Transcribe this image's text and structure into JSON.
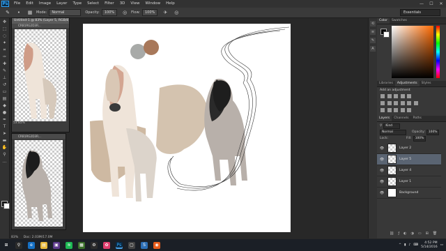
{
  "app": {
    "logo_text": "Ps"
  },
  "menu": {
    "items": [
      "File",
      "Edit",
      "Image",
      "Layer",
      "Type",
      "Select",
      "Filter",
      "3D",
      "View",
      "Window",
      "Help"
    ]
  },
  "window_controls": {
    "minimize": "—",
    "maximize": "☐",
    "close": "✕"
  },
  "options_bar": {
    "mode_label": "Mode:",
    "mode_value": "Normal",
    "opacity_label": "Opacity:",
    "opacity_value": "100%",
    "flow_label": "Flow:",
    "flow_value": "100%",
    "workspace": "Essentials"
  },
  "documents": {
    "floating_1": {
      "title": "Untitled-1 @ 83% (Layer 5, RGB/8) ×",
      "tab": "CRB1RG2D3R...",
      "zoom": "53.85%"
    },
    "floating_2": {
      "tab": "CRB1RG2D3R..."
    }
  },
  "main_status": {
    "zoom": "83%",
    "doc_info": "Doc: 2.03M/17.0M"
  },
  "color_panel": {
    "tabs": [
      "Color",
      "Swatches"
    ],
    "colors": {
      "canvas_swatch_1": "#a8aaa8",
      "canvas_swatch_2": "#a8785a"
    }
  },
  "adjustments_panel": {
    "tabs": [
      "Libraries",
      "Adjustments",
      "Styles"
    ],
    "hint": "Add an adjustment"
  },
  "layers_panel": {
    "tabs": [
      "Layers",
      "Channels",
      "Paths"
    ],
    "kind_label": "Kind",
    "blend_mode": "Normal",
    "opacity_label": "Opacity:",
    "opacity_value": "100%",
    "lock_label": "Lock:",
    "fill_label": "Fill:",
    "fill_value": "100%",
    "layers": [
      {
        "name": "Layer 2",
        "selected": false
      },
      {
        "name": "Layer 5",
        "selected": true
      },
      {
        "name": "Layer 4",
        "selected": false
      },
      {
        "name": "Layer 1",
        "selected": false
      },
      {
        "name": "Background",
        "selected": false
      }
    ]
  },
  "taskbar": {
    "clock_time": "4:52 PM",
    "clock_date": "5/14/2016"
  }
}
